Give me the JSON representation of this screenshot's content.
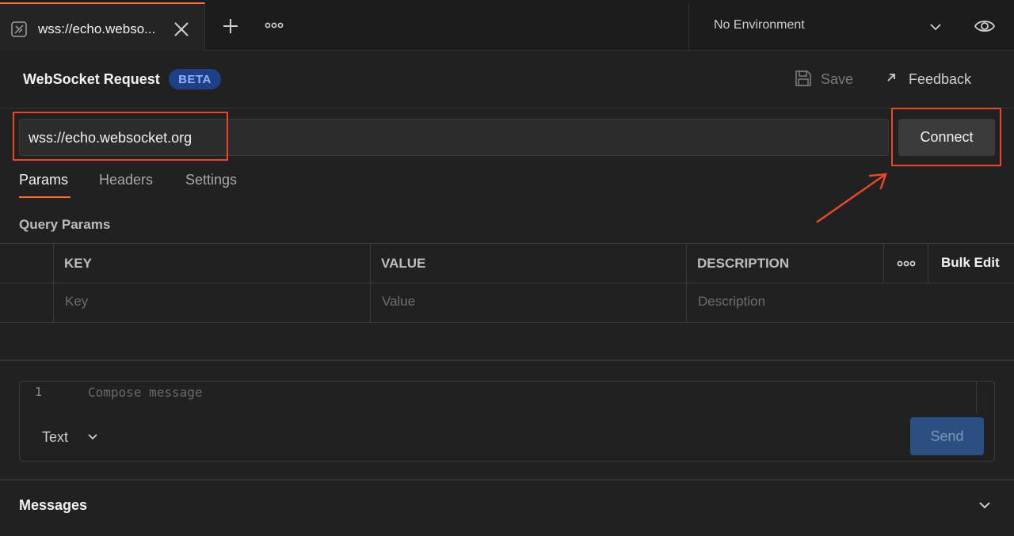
{
  "tabbar": {
    "active_tab_title": "wss://echo.webso...",
    "environment_label": "No Environment"
  },
  "header": {
    "title": "WebSocket Request",
    "badge": "BETA",
    "save_label": "Save",
    "feedback_label": "Feedback"
  },
  "url": {
    "value": "wss://echo.websocket.org",
    "connect_label": "Connect"
  },
  "request_tabs": [
    {
      "label": "Params",
      "active": true
    },
    {
      "label": "Headers",
      "active": false
    },
    {
      "label": "Settings",
      "active": false
    }
  ],
  "query_params": {
    "section_label": "Query Params",
    "columns": [
      "KEY",
      "VALUE",
      "DESCRIPTION"
    ],
    "bulk_edit_label": "Bulk Edit",
    "placeholders": {
      "key": "Key",
      "value": "Value",
      "description": "Description"
    }
  },
  "compose": {
    "line_number": "1",
    "placeholder": "Compose message",
    "format": "Text",
    "send_label": "Send"
  },
  "messages": {
    "label": "Messages"
  },
  "colors": {
    "accent": "#ff6c37",
    "highlight": "#e8472b",
    "beta_bg": "#1f3f86",
    "send_bg": "#2c4f82"
  }
}
